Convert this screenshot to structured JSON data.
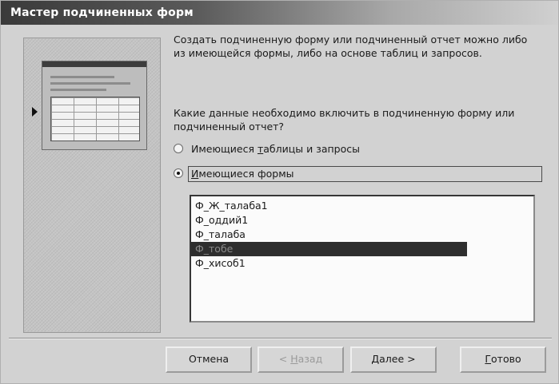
{
  "window": {
    "title": "Мастер подчиненных форм"
  },
  "intro_text": "Создать подчиненную форму или подчиненный отчет можно либо из имеющейся формы, либо на основе таблиц и запросов.",
  "question_text": "Какие данные необходимо включить в подчиненную форму или подчиненный отчет?",
  "options": [
    {
      "pre": "Имеющиеся ",
      "accel": "т",
      "post": "аблицы и запросы",
      "checked": false
    },
    {
      "pre": "",
      "accel": "И",
      "post": "меющиеся формы",
      "checked": true
    }
  ],
  "forms_list": {
    "items": [
      "Ф_Ж_талаба1",
      "Ф_оддий1",
      "Ф_талаба",
      "Ф_тобе",
      "Ф_хисоб1"
    ],
    "selected_index": 3
  },
  "buttons": {
    "cancel": {
      "label": "Отмена",
      "enabled": true
    },
    "back": {
      "prefix": "< ",
      "accel": "Н",
      "suffix": "азад",
      "enabled": false
    },
    "next": {
      "accel": "Д",
      "suffix": "алее >",
      "enabled": true
    },
    "finish": {
      "accel": "Г",
      "suffix": "отово",
      "enabled": true
    }
  }
}
